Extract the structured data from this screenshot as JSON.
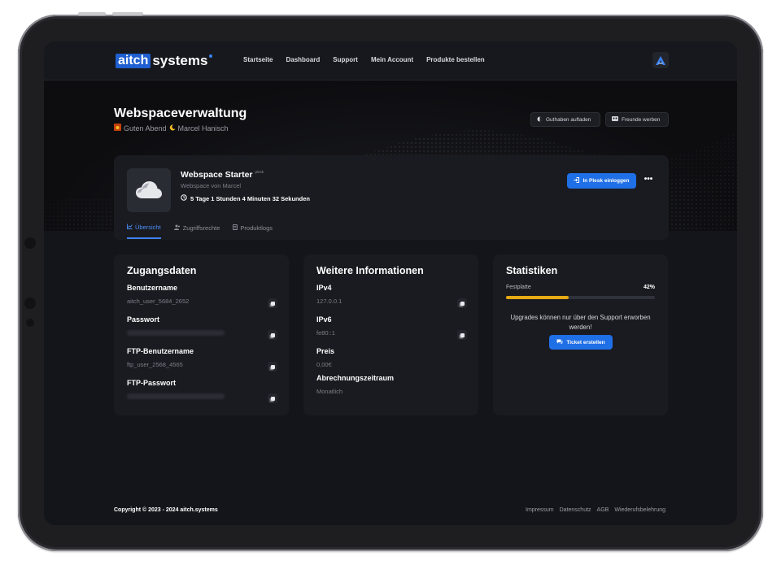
{
  "brand": {
    "logo_box": "aitch",
    "logo_rest": "systems"
  },
  "nav": {
    "items": [
      "Startseite",
      "Dashboard",
      "Support",
      "Mein Account",
      "Produkte bestellen"
    ]
  },
  "header": {
    "title": "Webspaceverwaltung",
    "greeting": "Guten Abend",
    "user_name": "Marcel Hanisch",
    "buttons": {
      "credit": "Guthaben aufladen",
      "referral": "Freunde werben"
    }
  },
  "product": {
    "name": "Webspace Starter",
    "tag": "plesk",
    "owner": "Webspace von Marcel",
    "time_remaining": "5 Tage 1 Stunden 4 Minuten 32 Sekunden",
    "login_button": "In Plesk einloggen",
    "more_button": "•••",
    "tabs": [
      "Übersicht",
      "Zugriffsrechte",
      "Produktlogs"
    ],
    "active_tab": 0
  },
  "access": {
    "title": "Zugangsdaten",
    "username_label": "Benutzername",
    "username_value": "aitch_user_5684_2652",
    "password_label": "Passwort",
    "ftp_user_label": "FTP-Benutzername",
    "ftp_user_value": "ftp_user_2568_4565",
    "ftp_password_label": "FTP-Passwort"
  },
  "info": {
    "title": "Weitere Informationen",
    "ipv4_label": "IPv4",
    "ipv4_value": "127.0.0.1",
    "ipv6_label": "IPv6",
    "ipv6_value": "fe80::1",
    "price_label": "Preis",
    "price_value": "0,00€",
    "billing_label": "Abrechnungszeitraum",
    "billing_value": "Monatlich"
  },
  "stats": {
    "title": "Statistiken",
    "disk_label": "Festplatte",
    "disk_percent_text": "42%",
    "disk_percent": 42,
    "note": "Upgrades können nur über den Support erworben werden!",
    "ticket_button": "Ticket erstellen"
  },
  "footer": {
    "copyright": "Copyright © 2023 - 2024 aitch.systems",
    "links": [
      "Impressum",
      "Datenschutz",
      "AGB",
      "Wiederufsbelehrung"
    ]
  },
  "colors": {
    "accent": "#1f6fe6",
    "progress": "#e5a913",
    "background": "#14151a",
    "card": "#1a1b21"
  }
}
